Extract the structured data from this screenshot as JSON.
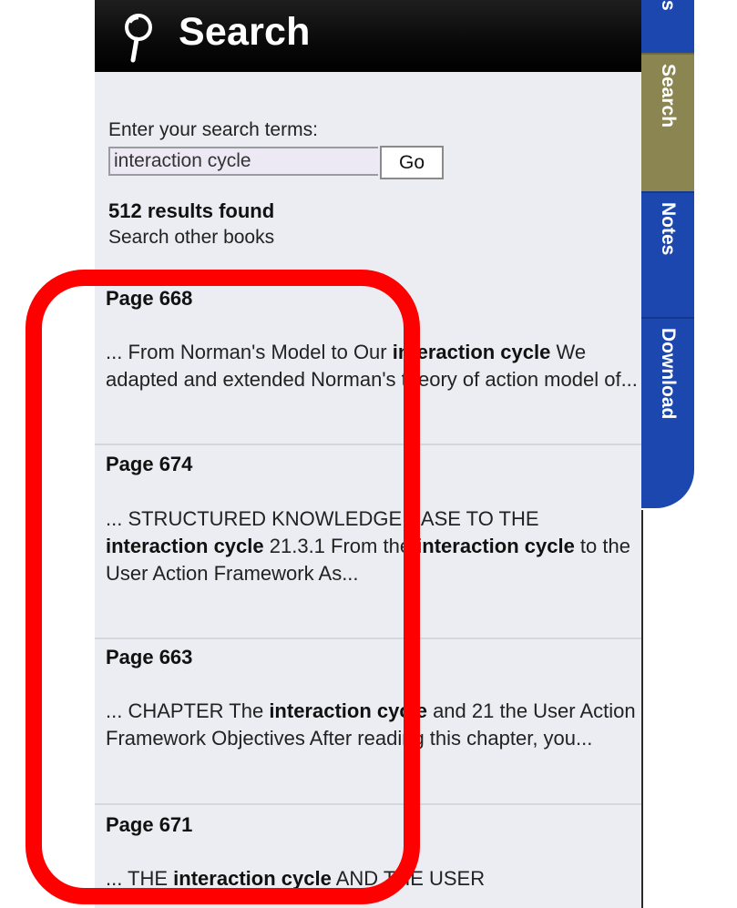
{
  "header": {
    "title": "Search",
    "icon": "magnifier-icon"
  },
  "search": {
    "prompt": "Enter your search terms:",
    "value": "interaction cycle",
    "go_label": "Go"
  },
  "results_summary": {
    "count_text": "512 results found",
    "other_books_link": "Search other books"
  },
  "results": [
    {
      "page": "Page 668",
      "snippet": [
        {
          "text": "... From Norman's Model to Our ",
          "bold": false
        },
        {
          "text": "interaction cycle",
          "bold": true
        },
        {
          "text": " We adapted and extended Norman's theory of action model of...",
          "bold": false
        }
      ]
    },
    {
      "page": "Page 674",
      "snippet": [
        {
          "text": "... STRUCTURED KNOWLEDGE BASE TO THE ",
          "bold": false
        },
        {
          "text": "interaction cycle",
          "bold": true
        },
        {
          "text": " 21.3.1 From the ",
          "bold": false
        },
        {
          "text": "interaction cycle",
          "bold": true
        },
        {
          "text": " to the User Action Framework As...",
          "bold": false
        }
      ]
    },
    {
      "page": "Page 663",
      "snippet": [
        {
          "text": "... CHAPTER The ",
          "bold": false
        },
        {
          "text": "interaction cycle",
          "bold": true
        },
        {
          "text": " and 21 the User Action Framework Objectives After reading this chapter, you...",
          "bold": false
        }
      ]
    },
    {
      "page": "Page 671",
      "snippet": [
        {
          "text": "... THE ",
          "bold": false
        },
        {
          "text": "interaction cycle",
          "bold": true
        },
        {
          "text": " AND THE USER",
          "bold": false
        }
      ]
    }
  ],
  "tabs": [
    {
      "label": "s",
      "active": false
    },
    {
      "label": "Search",
      "active": true
    },
    {
      "label": "Notes",
      "active": false
    },
    {
      "label": "Download",
      "active": false
    }
  ],
  "colors": {
    "panel_background": "#ecedf3",
    "header_background": "#000000",
    "tab_blue": "#1c47ae",
    "tab_active": "#8b8552",
    "annotation_red": "#ff0000"
  }
}
